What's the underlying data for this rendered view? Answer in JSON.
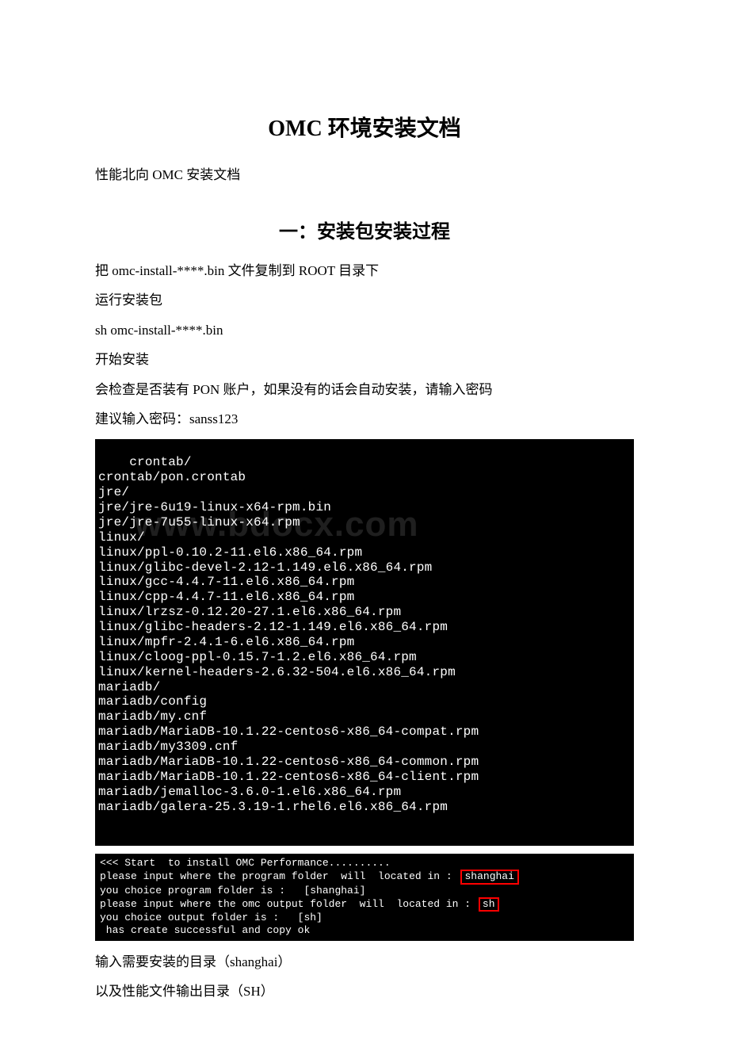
{
  "title": "OMC 环境安装文档",
  "intro": "性能北向 OMC 安装文档",
  "section1_heading": "一：安装包安装过程",
  "p1": "把 omc-install-****.bin 文件复制到 ROOT 目录下",
  "p2": "运行安装包",
  "p3": "sh omc-install-****.bin",
  "p4": "开始安装",
  "p5": "会检查是否装有 PON 账户，如果没有的话会自动安装，请输入密码",
  "p6": "建议输入密码：sanss123",
  "terminal1": "crontab/\ncrontab/pon.crontab\njre/\njre/jre-6u19-linux-x64-rpm.bin\njre/jre-7u55-linux-x64.rpm\nlinux/\nlinux/ppl-0.10.2-11.el6.x86_64.rpm\nlinux/glibc-devel-2.12-1.149.el6.x86_64.rpm\nlinux/gcc-4.4.7-11.el6.x86_64.rpm\nlinux/cpp-4.4.7-11.el6.x86_64.rpm\nlinux/lrzsz-0.12.20-27.1.el6.x86_64.rpm\nlinux/glibc-headers-2.12-1.149.el6.x86_64.rpm\nlinux/mpfr-2.4.1-6.el6.x86_64.rpm\nlinux/cloog-ppl-0.15.7-1.2.el6.x86_64.rpm\nlinux/kernel-headers-2.6.32-504.el6.x86_64.rpm\nmariadb/\nmariadb/config\nmariadb/my.cnf\nmariadb/MariaDB-10.1.22-centos6-x86_64-compat.rpm\nmariadb/my3309.cnf\nmariadb/MariaDB-10.1.22-centos6-x86_64-common.rpm\nmariadb/MariaDB-10.1.22-centos6-x86_64-client.rpm\nmariadb/jemalloc-3.6.0-1.el6.x86_64.rpm\nmariadb/galera-25.3.19-1.rhel6.el6.x86_64.rpm",
  "watermark": "www.bdocx.com",
  "terminal2": {
    "l1": "<<< Start  to install OMC Performance..........",
    "l2a": "please input where the program folder  will  located in :",
    "l2b": "shanghai",
    "l3": "you choice program folder is :   [shanghai]",
    "l4a": "please input where the omc output folder  will  located in :",
    "l4b": "sh",
    "l5": "you choice output folder is :   [sh]",
    "l6": " has create successful and copy ok"
  },
  "p7": "输入需要安装的目录（shanghai）",
  "p8": "以及性能文件输出目录（SH）"
}
